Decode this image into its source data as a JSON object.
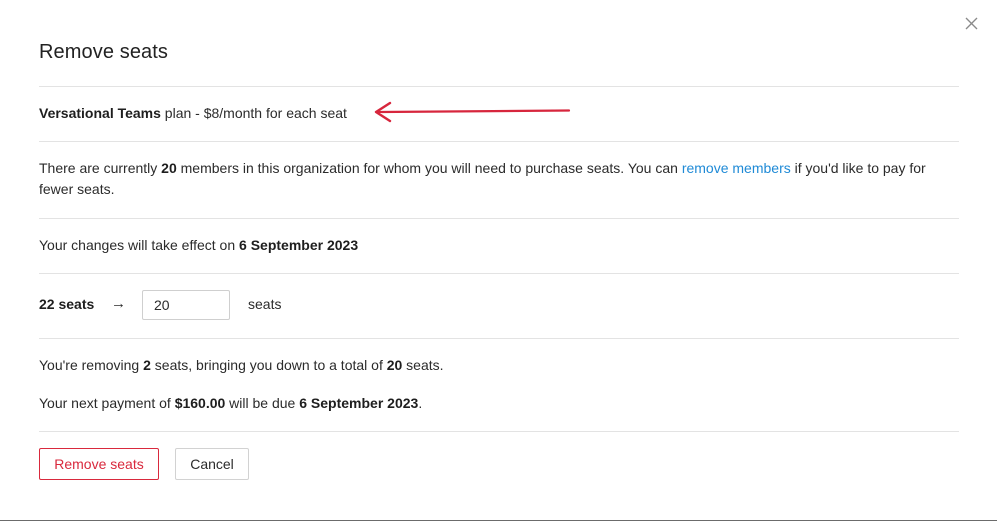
{
  "dialog": {
    "title": "Remove seats",
    "close_icon": "close-icon"
  },
  "plan": {
    "name": "Versational Teams",
    "price_text": " plan - $8/month for each seat",
    "annotation_color": "#d7263d"
  },
  "members_notice": {
    "prefix": "There are currently ",
    "count": "20",
    "middle": " members in this organization for whom you will need to purchase seats. You can ",
    "link_text": "remove members",
    "suffix": " if you'd like to pay for fewer seats."
  },
  "effective": {
    "prefix": "Your changes will take effect on ",
    "date": "6 September 2023"
  },
  "seats": {
    "current_label": "22 seats",
    "arrow": "→",
    "input_value": "20",
    "unit": "seats"
  },
  "summary": {
    "p1": "You're removing ",
    "removing": "2",
    "p2": " seats, bringing you down to a total of ",
    "total": "20",
    "p3": " seats."
  },
  "payment": {
    "p1": "Your next payment of ",
    "amount": "$160.00",
    "p2": " will be due ",
    "date": "6 September 2023",
    "p3": "."
  },
  "buttons": {
    "remove": "Remove seats",
    "cancel": "Cancel"
  },
  "colors": {
    "link": "#1f8ad6",
    "danger": "#d9293d"
  }
}
